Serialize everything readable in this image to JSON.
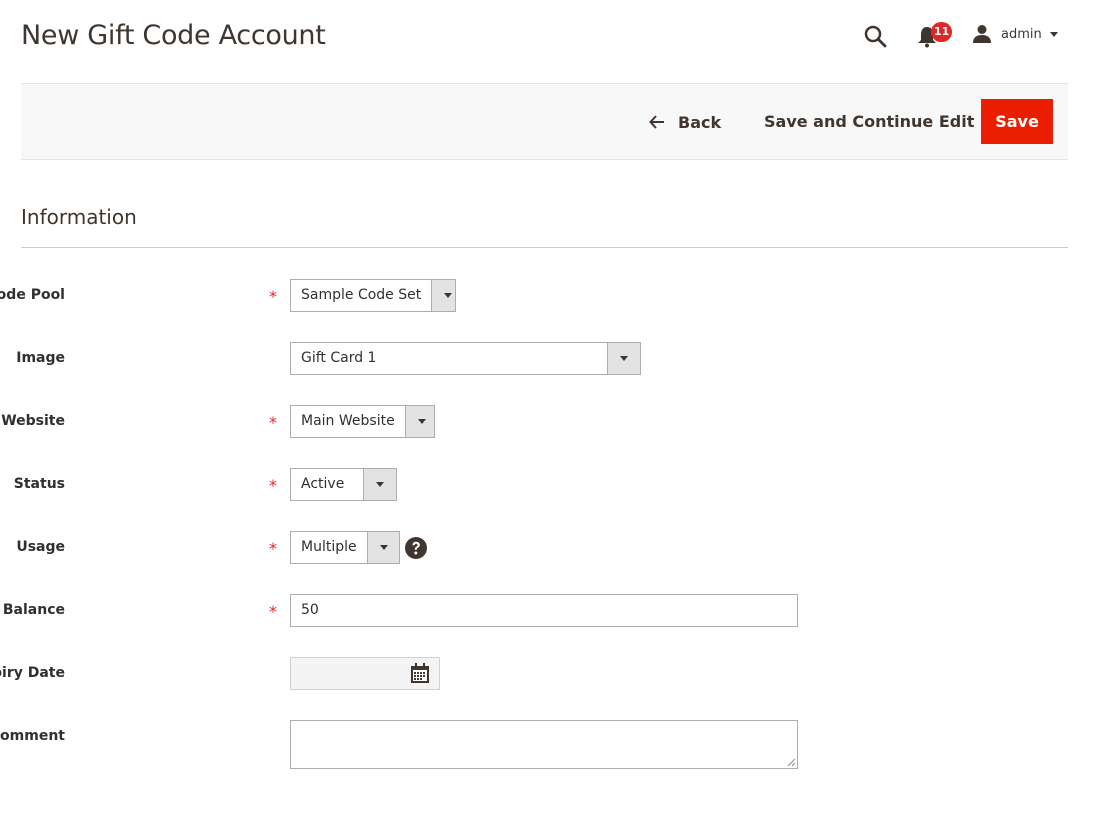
{
  "header": {
    "title": "New Gift Code Account",
    "notifications_count": "11",
    "user_name": "admin"
  },
  "toolbar": {
    "back_label": "Back",
    "save_continue_label": "Save and Continue Edit",
    "save_label": "Save"
  },
  "section": {
    "title": "Information"
  },
  "form": {
    "code_pool": {
      "label": "Code Pool",
      "required": true,
      "value": "Sample Code Set"
    },
    "image": {
      "label": "Image",
      "required": false,
      "value": "Gift Card 1"
    },
    "website": {
      "label": "Website",
      "required": true,
      "value": "Main Website"
    },
    "status": {
      "label": "Status",
      "required": true,
      "value": "Active"
    },
    "usage": {
      "label": "Usage",
      "required": true,
      "value": "Multiple"
    },
    "balance": {
      "label": "Balance",
      "required": true,
      "value": "50"
    },
    "expiry_date": {
      "label": "Expiry Date",
      "required": false,
      "value": ""
    },
    "comment": {
      "label": "Comment",
      "required": false,
      "value": ""
    }
  },
  "required_marker": "*",
  "colors": {
    "primary_action": "#eb1e00",
    "badge": "#e22626",
    "required": "#e22626",
    "text": "#41362f"
  }
}
